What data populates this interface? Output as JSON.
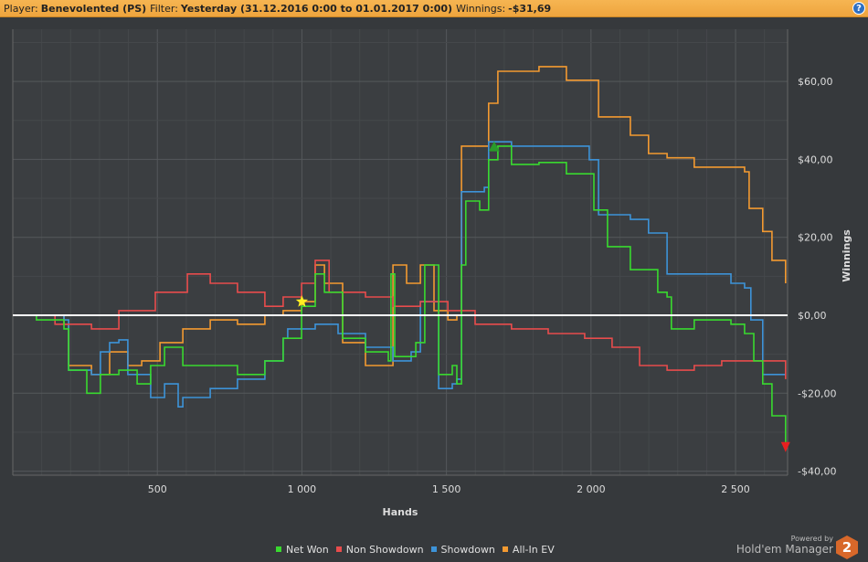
{
  "header": {
    "player_label": "Player:",
    "player": "Benevolented (PS)",
    "filter_label": "Filter:",
    "filter": "Yesterday (31.12.2016 0:00 to 01.01.2017 0:00)",
    "winnings_label": "Winnings:",
    "winnings": "-$31,69",
    "help": "?"
  },
  "brand": {
    "powered": "Powered by",
    "name": "Hold'em Manager",
    "logo": "2"
  },
  "chart_data": {
    "type": "line",
    "title": "",
    "xlabel": "Hands",
    "ylabel": "Winnings",
    "xlim": [
      0,
      2680
    ],
    "ylim": [
      -40,
      72
    ],
    "xticks": [
      500,
      1000,
      1500,
      2000,
      2500
    ],
    "xtick_labels": [
      "500",
      "1 000",
      "1 500",
      "2 000",
      "2 500"
    ],
    "yticks": [
      -40,
      -20,
      0,
      20,
      40,
      60
    ],
    "ytick_labels": [
      "-$40,00",
      "-$20,00",
      "$0,00",
      "$20,00",
      "$40,00",
      "$60,00"
    ],
    "grid": true,
    "legend_position": "bottom",
    "series": [
      {
        "name": "Net Won",
        "color": "#39d92f",
        "x": [
          0,
          82,
          177,
          193,
          256,
          303,
          367,
          430,
          477,
          525,
          588,
          777,
          872,
          935,
          999,
          1046,
          1078,
          1141,
          1220,
          1299,
          1308,
          1321,
          1394,
          1425,
          1473,
          1520,
          1536,
          1552,
          1567,
          1615,
          1646,
          1678,
          1725,
          1820,
          1915,
          1978,
          2010,
          2057,
          2136,
          2231,
          2263,
          2278,
          2357,
          2484,
          2531,
          2563,
          2594,
          2626,
          2673
        ],
        "y": [
          0,
          -1.2,
          -3.5,
          -14.1,
          -20,
          -15.2,
          -14.1,
          -17.6,
          -12.9,
          -8.2,
          -12.9,
          -15.2,
          -11.7,
          -5.9,
          2.3,
          10.6,
          5.9,
          -5.9,
          -9.4,
          -11.7,
          10.6,
          -10.6,
          -7,
          12.9,
          -15.2,
          -12.9,
          -17.6,
          12.9,
          29.3,
          27,
          39.9,
          43.4,
          38.7,
          39.2,
          36.3,
          36.3,
          27,
          17.6,
          11.7,
          5.9,
          4.7,
          -3.5,
          -1.2,
          -2.3,
          -4.7,
          -11.7,
          -17.6,
          -25.8,
          -33.7
        ]
      },
      {
        "name": "Non Showdown",
        "color": "#e84c4c",
        "x": [
          0,
          146,
          272,
          367,
          493,
          604,
          683,
          777,
          872,
          935,
          999,
          1046,
          1094,
          1220,
          1315,
          1410,
          1505,
          1599,
          1725,
          1852,
          1978,
          2073,
          2168,
          2263,
          2357,
          2452,
          2547,
          2626,
          2673
        ],
        "y": [
          0,
          -2.3,
          -3.5,
          1.2,
          5.9,
          10.6,
          8.2,
          5.9,
          2.3,
          4.7,
          8.2,
          14.1,
          5.9,
          4.7,
          2.3,
          3.5,
          1.2,
          -2.3,
          -3.5,
          -4.7,
          -5.9,
          -8.2,
          -12.9,
          -14.1,
          -12.9,
          -11.7,
          -11.7,
          -11.7,
          -16.4
        ]
      },
      {
        "name": "Showdown",
        "color": "#3d93d8",
        "x": [
          0,
          177,
          193,
          272,
          303,
          335,
          367,
          398,
          477,
          525,
          572,
          588,
          683,
          777,
          872,
          935,
          951,
          1015,
          1046,
          1125,
          1220,
          1315,
          1378,
          1410,
          1473,
          1520,
          1536,
          1552,
          1631,
          1646,
          1725,
          1915,
          1994,
          2026,
          2136,
          2199,
          2263,
          2405,
          2484,
          2531,
          2553,
          2594,
          2673
        ],
        "y": [
          0,
          -1.2,
          -14.1,
          -15.2,
          -9.4,
          -7,
          -6.3,
          -15.2,
          -21.1,
          -17.6,
          -23.5,
          -21.1,
          -18.8,
          -16.4,
          -11.7,
          -5.9,
          -3.5,
          -3.5,
          -2.3,
          -4.7,
          -8.2,
          -11.7,
          -9.4,
          3.5,
          -18.8,
          -17.6,
          -16.4,
          31.7,
          32.8,
          44.5,
          43.4,
          43.4,
          39.9,
          25.8,
          24.6,
          21.1,
          10.6,
          10.6,
          8.2,
          7,
          -1.2,
          -15.2,
          -15.2
        ]
      },
      {
        "name": "All-In EV",
        "color": "#f39a31",
        "x": [
          0,
          177,
          193,
          272,
          335,
          398,
          446,
          509,
          588,
          683,
          777,
          872,
          935,
          999,
          1046,
          1078,
          1141,
          1220,
          1315,
          1362,
          1410,
          1457,
          1505,
          1536,
          1552,
          1631,
          1646,
          1678,
          1725,
          1820,
          1915,
          1994,
          2026,
          2136,
          2199,
          2263,
          2357,
          2484,
          2531,
          2547,
          2594,
          2626,
          2673
        ],
        "y": [
          0,
          -2.3,
          -12.9,
          -15.2,
          -9.4,
          -12.9,
          -11.7,
          -7,
          -3.5,
          -1.2,
          -2.3,
          0,
          1.2,
          3.5,
          12.9,
          8.2,
          -7,
          -12.9,
          12.9,
          8.2,
          12.9,
          1.2,
          -1.2,
          0,
          43.4,
          43.4,
          54.4,
          62.6,
          62.6,
          63.8,
          60.3,
          60.3,
          50.9,
          46.2,
          41.5,
          40.4,
          38,
          38,
          36.8,
          27.4,
          21.5,
          14.1,
          8.2
        ]
      }
    ],
    "markers": [
      {
        "type": "star",
        "x": 1000,
        "y": 3.5,
        "color": "#ffee22"
      },
      {
        "type": "max",
        "x": 1665,
        "y": 43,
        "color": "#2a9a2a"
      },
      {
        "type": "min",
        "x": 2673,
        "y": -33.7,
        "color": "#e82020"
      }
    ]
  }
}
